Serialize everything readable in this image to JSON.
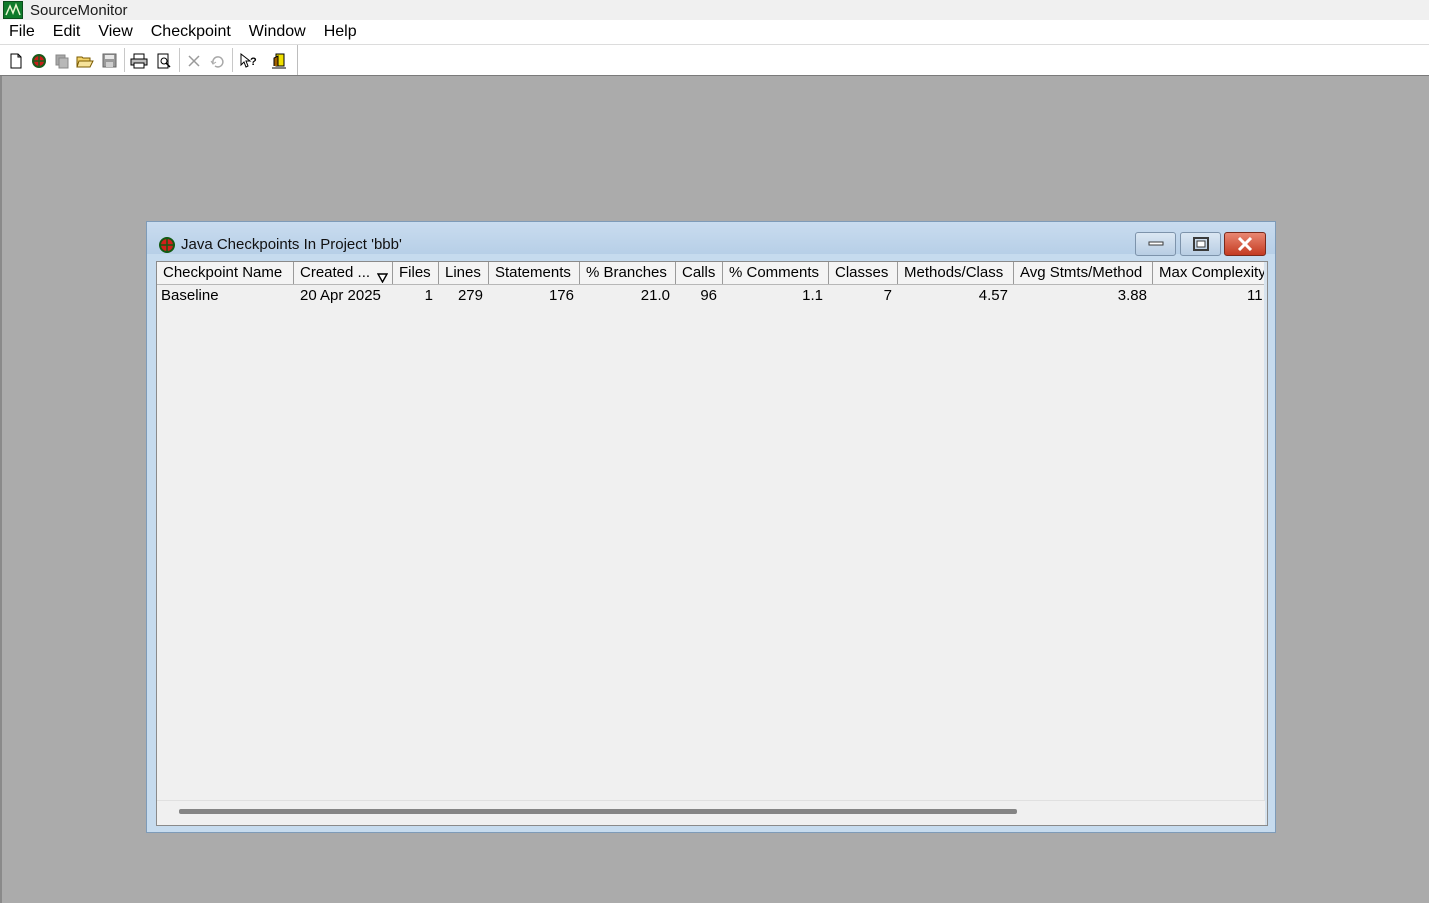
{
  "app": {
    "title": "SourceMonitor"
  },
  "menu": [
    "File",
    "Edit",
    "View",
    "Checkpoint",
    "Window",
    "Help"
  ],
  "toolbar": {
    "buttons": [
      "new-project-icon",
      "new-checkpoint-icon",
      "copy-icon",
      "open-folder-icon",
      "save-icon",
      "print-icon",
      "print-preview-icon",
      "delete-icon",
      "undo-icon",
      "context-help-icon",
      "exit-icon"
    ]
  },
  "child": {
    "title": "Java Checkpoints In Project 'bbb'",
    "columns": [
      "Checkpoint Name",
      "Created ...",
      "Files",
      "Lines",
      "Statements",
      "% Branches",
      "Calls",
      "% Comments",
      "Classes",
      "Methods/Class",
      "Avg Stmts/Method",
      "Max Complexity"
    ],
    "rows": [
      [
        "Baseline",
        "20 Apr 2025",
        "1",
        "279",
        "176",
        "21.0",
        "96",
        "1.1",
        "7",
        "4.57",
        "3.88",
        "11"
      ]
    ]
  },
  "colors": {
    "mdi_background": "#ababab",
    "child_frame": "#c6dbee",
    "close_button": "#c43b22"
  }
}
